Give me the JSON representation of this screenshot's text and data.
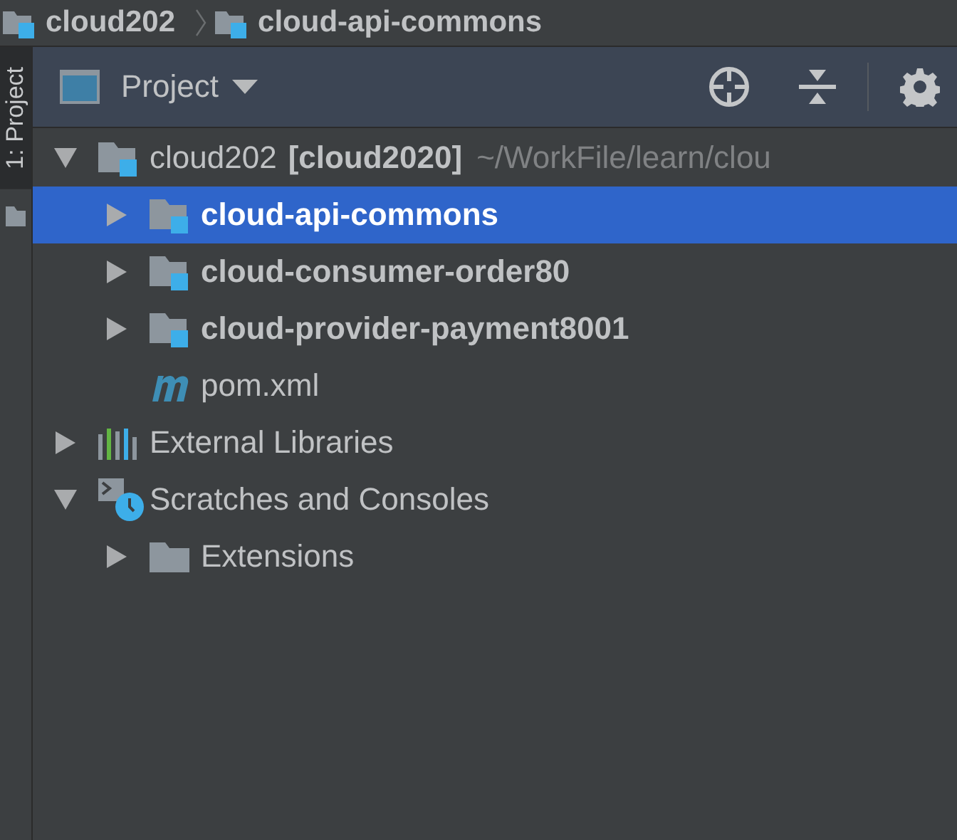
{
  "breadcrumb": [
    {
      "label": "cloud202"
    },
    {
      "label": "cloud-api-commons"
    }
  ],
  "side_tab": {
    "label": "1: Project",
    "selected": true
  },
  "toolbar": {
    "title": "Project"
  },
  "tree": [
    {
      "kind": "project",
      "label": "cloud202",
      "tag": "[cloud2020]",
      "path": "~/WorkFile/learn/clou",
      "expanded": true,
      "selected": false,
      "children": [
        {
          "kind": "module",
          "label": "cloud-api-commons",
          "expanded": false,
          "selected": true
        },
        {
          "kind": "module",
          "label": "cloud-consumer-order80",
          "expanded": false,
          "selected": false
        },
        {
          "kind": "module",
          "label": "cloud-provider-payment8001",
          "expanded": false,
          "selected": false
        },
        {
          "kind": "maven",
          "label": "pom.xml",
          "selected": false
        }
      ]
    },
    {
      "kind": "library",
      "label": "External Libraries",
      "expanded": false,
      "selected": false
    },
    {
      "kind": "scratches",
      "label": "Scratches and Consoles",
      "expanded": true,
      "selected": false,
      "children": [
        {
          "kind": "folder",
          "label": "Extensions",
          "expanded": false,
          "selected": false
        }
      ]
    }
  ]
}
